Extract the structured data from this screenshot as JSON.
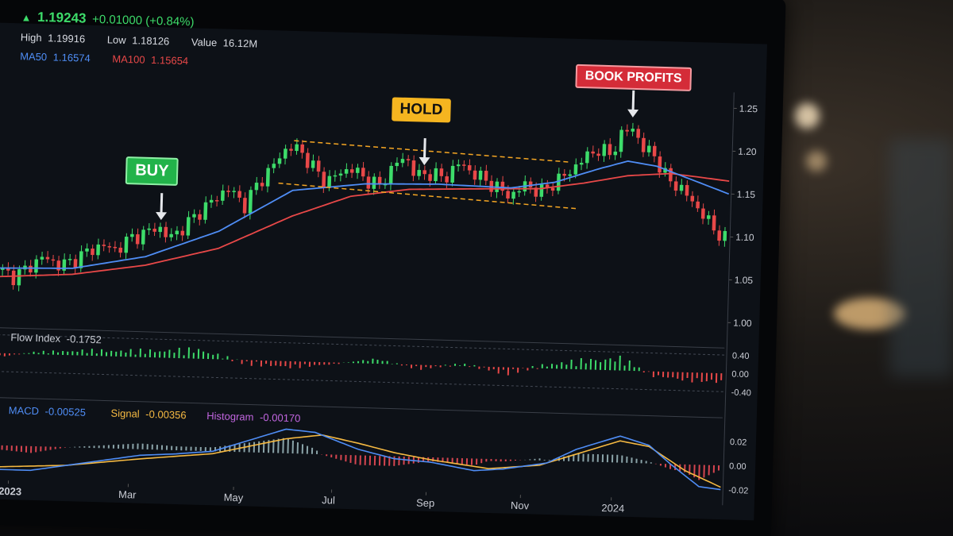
{
  "ticker": {
    "last": "1.19243",
    "change": "+0.01000 (+0.84%)",
    "high_label": "High",
    "high": "1.19916",
    "low_label": "Low",
    "low": "1.18126",
    "volume_label": "Value",
    "volume": "16.12M",
    "ma50_label": "MA50",
    "ma50": "1.16574",
    "ma100_label": "MA100",
    "ma100": "1.15654"
  },
  "signals": {
    "buy": "BUY",
    "hold": "HOLD",
    "book": "BOOK PROFITS"
  },
  "indicators": {
    "flow_label": "Flow Index",
    "flow_value": "-0.1752",
    "macd_label": "MACD",
    "macd_value": "-0.00525",
    "signal_label": "Signal",
    "signal_value": "-0.00356",
    "hist_label": "Histogram",
    "hist_value": "-0.00170"
  },
  "colors": {
    "up": "#3ddc6a",
    "down": "#e84848",
    "ma50": "#4f8df5",
    "ma100": "#e84848",
    "channel": "#f5a623",
    "signal": "#f5b942",
    "hist_label": "#c266e0"
  },
  "chart_data": [
    {
      "type": "candlestick",
      "title": "",
      "y_ticks": [
        "1.25",
        "1.20",
        "1.15",
        "1.10",
        "1.05",
        "1.00"
      ],
      "ylim": [
        1.0,
        1.25
      ],
      "x_ticks": [
        "2023",
        "Mar",
        "May",
        "Jul",
        "Sep",
        "Nov",
        "2024"
      ],
      "x_tick_pos": [
        0.02,
        0.185,
        0.33,
        0.465,
        0.595,
        0.725,
        0.85
      ],
      "close_series": [
        [
          0.0,
          1.038
        ],
        [
          0.02,
          1.03
        ],
        [
          0.04,
          1.042
        ],
        [
          0.06,
          1.055
        ],
        [
          0.08,
          1.045
        ],
        [
          0.1,
          1.05
        ],
        [
          0.12,
          1.062
        ],
        [
          0.14,
          1.07
        ],
        [
          0.16,
          1.065
        ],
        [
          0.18,
          1.08
        ],
        [
          0.2,
          1.085
        ],
        [
          0.215,
          1.095
        ],
        [
          0.23,
          1.08
        ],
        [
          0.25,
          1.092
        ],
        [
          0.27,
          1.11
        ],
        [
          0.29,
          1.125
        ],
        [
          0.31,
          1.14
        ],
        [
          0.325,
          1.13
        ],
        [
          0.335,
          1.12
        ],
        [
          0.35,
          1.145
        ],
        [
          0.37,
          1.165
        ],
        [
          0.385,
          1.185
        ],
        [
          0.4,
          1.192
        ],
        [
          0.415,
          1.18
        ],
        [
          0.43,
          1.165
        ],
        [
          0.445,
          1.15
        ],
        [
          0.46,
          1.16
        ],
        [
          0.48,
          1.168
        ],
        [
          0.5,
          1.155
        ],
        [
          0.52,
          1.148
        ],
        [
          0.54,
          1.175
        ],
        [
          0.555,
          1.182
        ],
        [
          0.57,
          1.16
        ],
        [
          0.59,
          1.165
        ],
        [
          0.61,
          1.158
        ],
        [
          0.625,
          1.178
        ],
        [
          0.64,
          1.17
        ],
        [
          0.66,
          1.16
        ],
        [
          0.68,
          1.15
        ],
        [
          0.7,
          1.14
        ],
        [
          0.72,
          1.155
        ],
        [
          0.74,
          1.145
        ],
        [
          0.76,
          1.158
        ],
        [
          0.78,
          1.17
        ],
        [
          0.8,
          1.188
        ],
        [
          0.82,
          1.198
        ],
        [
          0.835,
          1.192
        ],
        [
          0.85,
          1.215
        ],
        [
          0.865,
          1.225
        ],
        [
          0.88,
          1.2
        ],
        [
          0.895,
          1.195
        ],
        [
          0.91,
          1.17
        ],
        [
          0.925,
          1.16
        ],
        [
          0.94,
          1.15
        ],
        [
          0.955,
          1.135
        ],
        [
          0.97,
          1.12
        ],
        [
          0.985,
          1.105
        ],
        [
          1.0,
          1.095
        ]
      ],
      "ma50": [
        [
          0.0,
          1.04
        ],
        [
          0.1,
          1.042
        ],
        [
          0.2,
          1.058
        ],
        [
          0.3,
          1.09
        ],
        [
          0.4,
          1.14
        ],
        [
          0.5,
          1.15
        ],
        [
          0.6,
          1.152
        ],
        [
          0.7,
          1.15
        ],
        [
          0.76,
          1.158
        ],
        [
          0.82,
          1.175
        ],
        [
          0.86,
          1.185
        ],
        [
          0.9,
          1.18
        ],
        [
          0.95,
          1.165
        ],
        [
          1.0,
          1.15
        ]
      ],
      "ma100": [
        [
          0.0,
          1.03
        ],
        [
          0.1,
          1.035
        ],
        [
          0.2,
          1.048
        ],
        [
          0.3,
          1.07
        ],
        [
          0.4,
          1.11
        ],
        [
          0.48,
          1.135
        ],
        [
          0.56,
          1.145
        ],
        [
          0.66,
          1.148
        ],
        [
          0.74,
          1.15
        ],
        [
          0.8,
          1.158
        ],
        [
          0.86,
          1.168
        ],
        [
          0.92,
          1.172
        ],
        [
          1.0,
          1.165
        ]
      ],
      "channel": {
        "upper": [
          [
            0.4,
            1.198
          ],
          [
            0.78,
            1.182
          ]
        ],
        "lower": [
          [
            0.38,
            1.148
          ],
          [
            0.79,
            1.128
          ]
        ]
      },
      "signals": [
        {
          "label": "BUY",
          "x": 0.22
        },
        {
          "label": "HOLD",
          "x": 0.58
        },
        {
          "label": "BOOK PROFITS",
          "x": 0.865
        }
      ]
    },
    {
      "type": "bar",
      "title": "Flow Index",
      "y_ticks": [
        "0.40",
        "0.00",
        "-0.40"
      ],
      "ylim": [
        -0.45,
        0.45
      ],
      "profile": [
        [
          0.0,
          -0.1
        ],
        [
          0.05,
          0.05
        ],
        [
          0.12,
          0.12
        ],
        [
          0.2,
          0.15
        ],
        [
          0.28,
          0.22
        ],
        [
          0.34,
          -0.08
        ],
        [
          0.4,
          -0.15
        ],
        [
          0.46,
          -0.05
        ],
        [
          0.52,
          0.12
        ],
        [
          0.58,
          -0.1
        ],
        [
          0.64,
          0.05
        ],
        [
          0.7,
          -0.15
        ],
        [
          0.76,
          0.1
        ],
        [
          0.82,
          0.25
        ],
        [
          0.86,
          0.3
        ],
        [
          0.9,
          -0.1
        ],
        [
          0.95,
          -0.2
        ],
        [
          1.0,
          -0.22
        ]
      ]
    },
    {
      "type": "line",
      "title": "MACD",
      "y_ticks": [
        "0.02",
        "0.00",
        "-0.02"
      ],
      "ylim": [
        -0.025,
        0.025
      ],
      "macd": [
        [
          0.0,
          -0.02
        ],
        [
          0.05,
          -0.02
        ],
        [
          0.1,
          -0.015
        ],
        [
          0.15,
          -0.01
        ],
        [
          0.2,
          -0.005
        ],
        [
          0.25,
          -0.003
        ],
        [
          0.3,
          0.0
        ],
        [
          0.35,
          0.01
        ],
        [
          0.4,
          0.02
        ],
        [
          0.44,
          0.018
        ],
        [
          0.5,
          0.005
        ],
        [
          0.55,
          -0.002
        ],
        [
          0.6,
          -0.004
        ],
        [
          0.66,
          -0.01
        ],
        [
          0.7,
          -0.008
        ],
        [
          0.76,
          -0.002
        ],
        [
          0.8,
          0.01
        ],
        [
          0.86,
          0.022
        ],
        [
          0.9,
          0.015
        ],
        [
          0.93,
          0.0
        ],
        [
          0.97,
          -0.018
        ],
        [
          1.0,
          -0.02
        ]
      ],
      "signal_line": [
        [
          0.0,
          -0.018
        ],
        [
          0.1,
          -0.015
        ],
        [
          0.2,
          -0.008
        ],
        [
          0.3,
          -0.002
        ],
        [
          0.4,
          0.012
        ],
        [
          0.45,
          0.016
        ],
        [
          0.5,
          0.01
        ],
        [
          0.55,
          0.003
        ],
        [
          0.6,
          -0.002
        ],
        [
          0.68,
          -0.008
        ],
        [
          0.75,
          -0.004
        ],
        [
          0.82,
          0.01
        ],
        [
          0.86,
          0.018
        ],
        [
          0.9,
          0.014
        ],
        [
          0.95,
          -0.005
        ],
        [
          1.0,
          -0.018
        ]
      ]
    }
  ]
}
